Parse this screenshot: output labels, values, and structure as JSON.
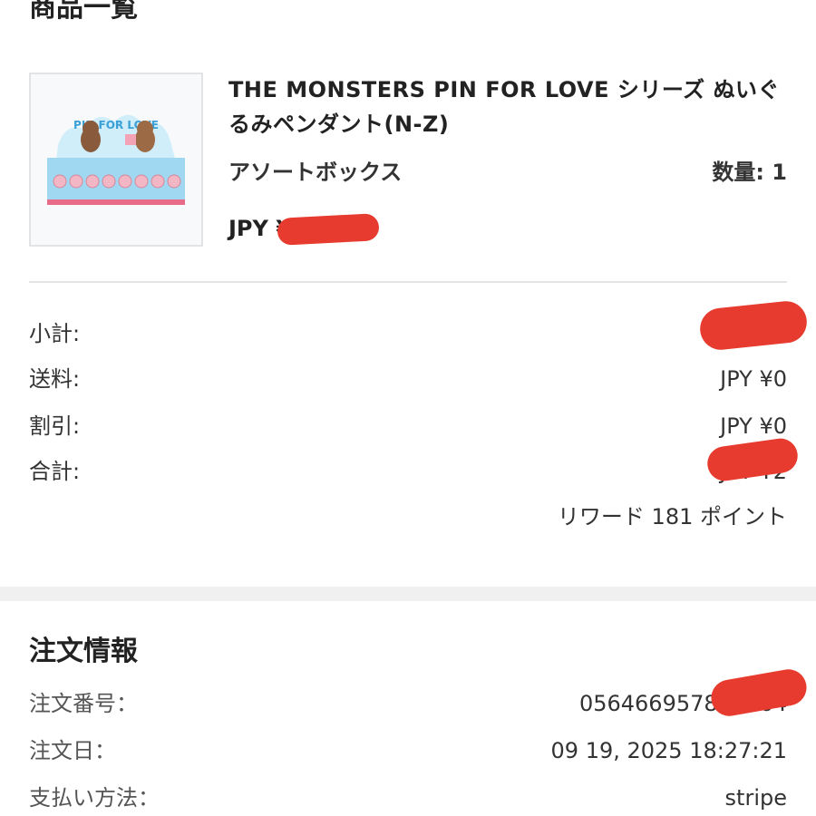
{
  "products_section": {
    "title": "商品一覧",
    "item": {
      "name": "THE MONSTERS PIN FOR LOVE シリーズ ぬいぐるみペンダント(N-Z)",
      "variant": "アソートボックス",
      "quantity": "数量: 1",
      "price": "JPY ¥",
      "image_caption": "PIN FOR LOVE"
    }
  },
  "summary": {
    "rows": [
      {
        "label": "小計:",
        "value": "JPY ¥"
      },
      {
        "label": "送料:",
        "value": "JPY ¥0"
      },
      {
        "label": "割引:",
        "value": "JPY ¥0"
      },
      {
        "label": "合計:",
        "value": "JPY ¥2"
      }
    ],
    "reward": "リワード 181 ポイント"
  },
  "order_info": {
    "title": "注文情報",
    "rows": [
      {
        "label": "注文番号：",
        "value": "056466957887264"
      },
      {
        "label": "注文日：",
        "value": "09 19, 2025 18:27:21"
      },
      {
        "label": "支払い方法：",
        "value": "stripe"
      }
    ]
  },
  "colors": {
    "redaction": "#e63b2e",
    "divider": "#e4e4e4",
    "band": "#f0f0f0"
  }
}
